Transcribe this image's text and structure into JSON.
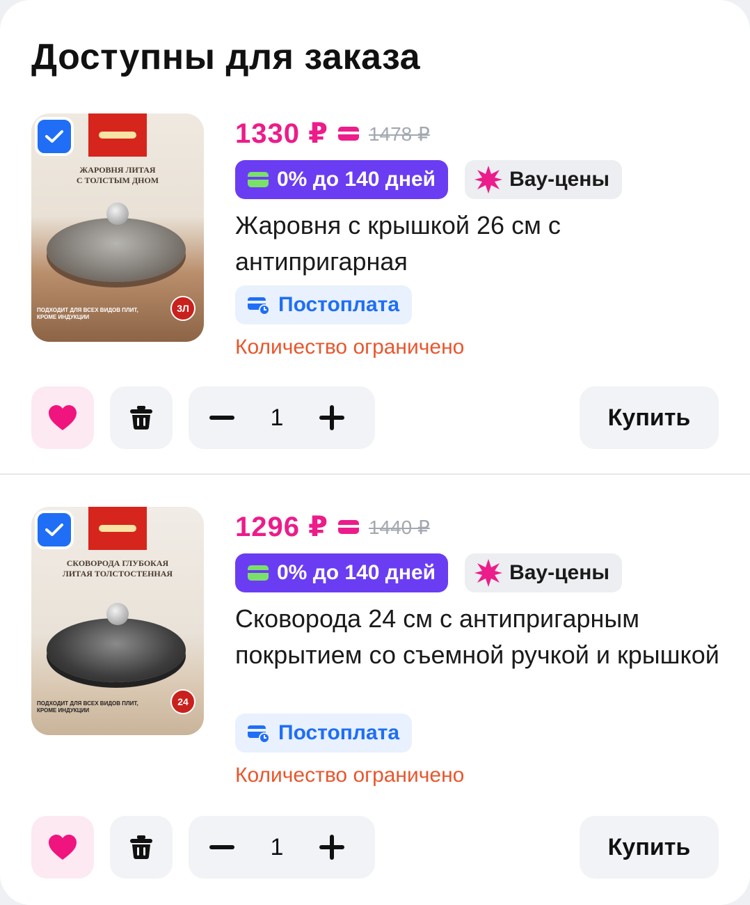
{
  "section": {
    "title": "Доступны для заказа"
  },
  "colors": {
    "accent_pink": "#ec1c8a",
    "purple": "#6a3df2",
    "blue": "#1f6ef5",
    "warning": "#e8562c"
  },
  "items": [
    {
      "checked": true,
      "image": {
        "title_line1": "ЖАРОВНЯ ЛИТАЯ",
        "title_line2": "С ТОЛСТЫМ ДНОМ",
        "bottom_text": "ПОДХОДИТ ДЛЯ ВСЕХ ВИДОВ ПЛИТ, КРОМЕ ИНДУКЦИИ",
        "size_badge": "3Л"
      },
      "price": "1330 ₽",
      "old_price": "1478 ₽",
      "installment_tag": "0% до 140 дней",
      "promo_tag": "Вау-цены",
      "name": "Жаровня с крышкой 26 см с антипригарная",
      "postpay": "Постоплата",
      "stock_note": "Количество ограничено",
      "quantity": "1",
      "buy_label": "Купить"
    },
    {
      "checked": true,
      "image": {
        "title_line1": "СКОВОРОДА ГЛУБОКАЯ",
        "title_line2": "ЛИТАЯ ТОЛСТОСТЕННАЯ",
        "bottom_text": "ПОДХОДИТ ДЛЯ ВСЕХ ВИДОВ ПЛИТ, КРОМЕ ИНДУКЦИИ",
        "size_badge": "24"
      },
      "price": "1296 ₽",
      "old_price": "1440 ₽",
      "installment_tag": "0% до 140 дней",
      "promo_tag": "Вау-цены",
      "name": "Сковорода 24 см с антипригарным покрытием со съемной ручкой и крышкой",
      "postpay": "Постоплата",
      "stock_note": "Количество ограничено",
      "quantity": "1",
      "buy_label": "Купить"
    }
  ]
}
